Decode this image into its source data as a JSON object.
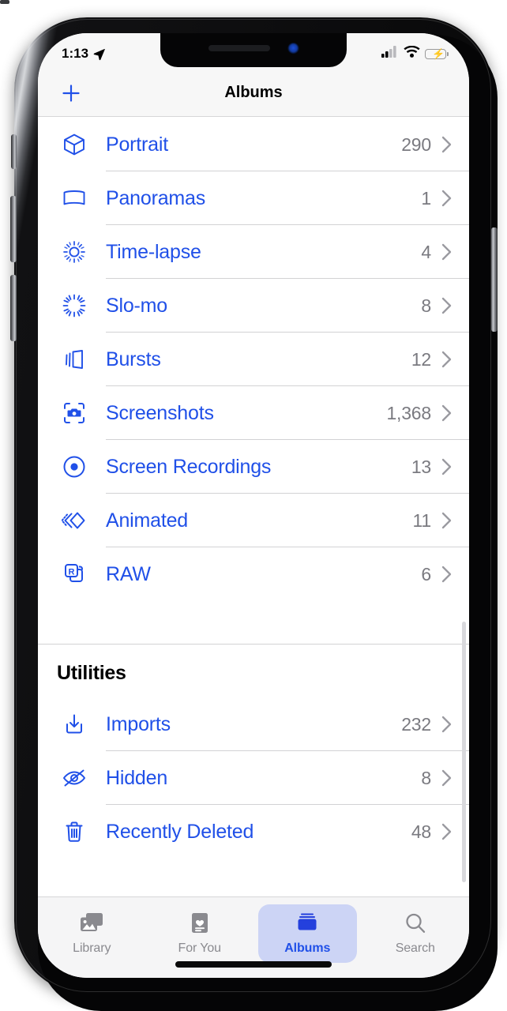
{
  "status_bar": {
    "time": "1:13",
    "location_icon": "location-arrow-icon",
    "cellular_icon": "cellular-signal-icon",
    "cellular_bars_filled": 2,
    "cellular_bars_total": 4,
    "wifi_icon": "wifi-icon",
    "battery_icon": "battery-charging-icon",
    "battery_charging": true,
    "battery_color": "#4cae4f"
  },
  "nav_bar": {
    "add_icon": "plus-icon",
    "title": "Albums"
  },
  "theme": {
    "accent": "#2050e8",
    "count_color": "#7a7a80",
    "separator": "#d2d2d4",
    "bar_background": "#f7f7f7",
    "selected_tab_pill": "#ccd4f5"
  },
  "media_types": {
    "rows": [
      {
        "label": "Portrait",
        "count": "290",
        "icon": "cube-icon"
      },
      {
        "label": "Panoramas",
        "count": "1",
        "icon": "panorama-icon"
      },
      {
        "label": "Time-lapse",
        "count": "4",
        "icon": "timelapse-icon"
      },
      {
        "label": "Slo-mo",
        "count": "8",
        "icon": "slomo-icon"
      },
      {
        "label": "Bursts",
        "count": "12",
        "icon": "bursts-icon"
      },
      {
        "label": "Screenshots",
        "count": "1,368",
        "icon": "screenshot-camera-icon"
      },
      {
        "label": "Screen Recordings",
        "count": "13",
        "icon": "record-circle-icon"
      },
      {
        "label": "Animated",
        "count": "11",
        "icon": "animated-diamond-icon"
      },
      {
        "label": "RAW",
        "count": "6",
        "icon": "raw-squares-icon"
      }
    ]
  },
  "utilities": {
    "header": "Utilities",
    "rows": [
      {
        "label": "Imports",
        "count": "232",
        "icon": "import-download-icon"
      },
      {
        "label": "Hidden",
        "count": "8",
        "icon": "eye-slash-icon"
      },
      {
        "label": "Recently Deleted",
        "count": "48",
        "icon": "trash-icon"
      }
    ]
  },
  "tab_bar": {
    "tabs": [
      {
        "label": "Library",
        "icon": "photos-stack-icon",
        "selected": false
      },
      {
        "label": "For You",
        "icon": "heart-card-icon",
        "selected": false
      },
      {
        "label": "Albums",
        "icon": "albums-folder-icon",
        "selected": true
      },
      {
        "label": "Search",
        "icon": "magnifier-icon",
        "selected": false
      }
    ]
  }
}
